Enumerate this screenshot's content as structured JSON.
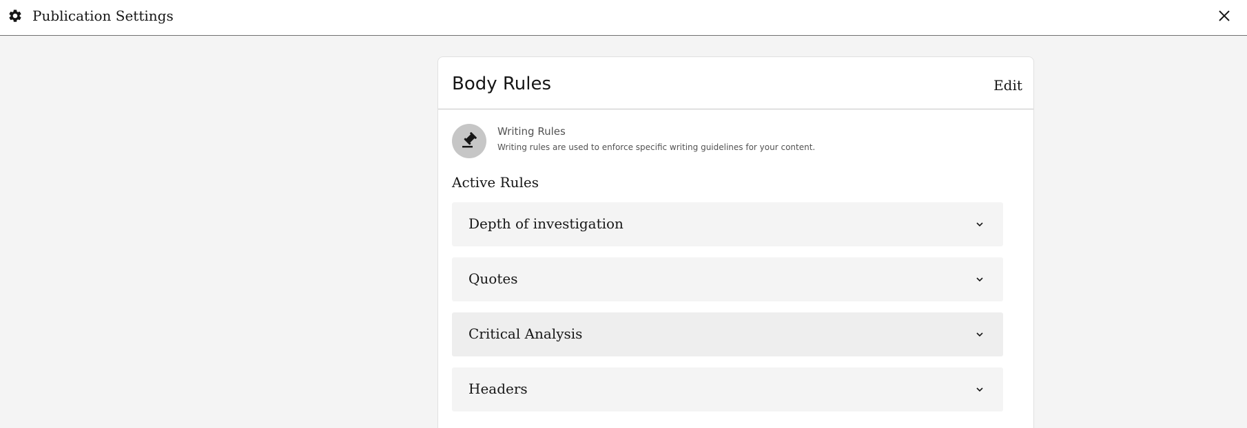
{
  "window": {
    "title": "Publication Settings",
    "gear_icon": "gear-icon",
    "close_icon": "close-icon"
  },
  "card": {
    "title": "Body Rules",
    "edit_label": "Edit"
  },
  "info": {
    "icon": "gavel-icon",
    "title": "Writing Rules",
    "description": "Writing rules are used to enforce specific writing guidelines for your content."
  },
  "active_rules": {
    "heading": "Active Rules",
    "items": [
      {
        "label": "Depth of investigation",
        "icon": "chevron-down-icon"
      },
      {
        "label": "Quotes",
        "icon": "chevron-down-icon"
      },
      {
        "label": "Critical Analysis",
        "icon": "chevron-down-icon"
      },
      {
        "label": "Headers",
        "icon": "chevron-down-icon"
      }
    ]
  },
  "colors": {
    "background": "#f4f4f4",
    "surface": "#ffffff",
    "rule_background": "#f4f4f4",
    "rule_hover_background": "#eeeeee",
    "avatar_background": "#c6c6c6",
    "text_primary": "#161616",
    "text_secondary": "#525252"
  }
}
